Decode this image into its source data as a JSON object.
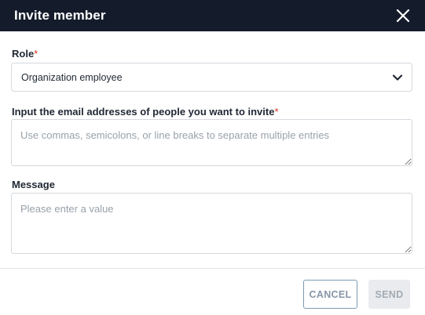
{
  "dialog": {
    "title": "Invite member",
    "close_icon": "close-icon"
  },
  "role": {
    "label": "Role",
    "required_mark": "*",
    "selected_value": "Organization employee",
    "dropdown_icon": "chevron-down-icon"
  },
  "emails": {
    "label": "Input the email addresses of people you want to invite",
    "required_mark": "*",
    "value": "",
    "placeholder": "Use commas, semicolons, or line breaks to separate multiple entries"
  },
  "message": {
    "label": "Message",
    "value": "",
    "placeholder": "Please enter a value"
  },
  "footer": {
    "cancel_label": "CANCEL",
    "send_label": "SEND"
  },
  "colors": {
    "header_bg": "#141c2b",
    "required": "#d93025",
    "cancel_border": "#7d9ab0",
    "send_disabled_bg": "#e9ebee"
  }
}
